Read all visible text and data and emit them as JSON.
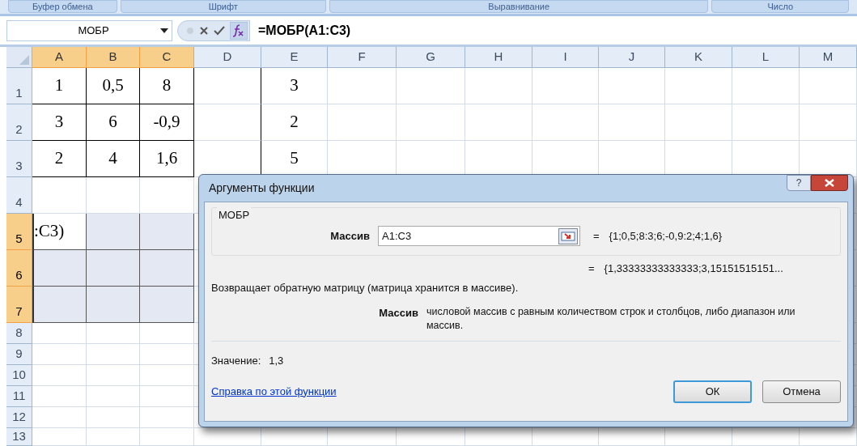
{
  "ribbon_groups": [
    "Буфер обмена",
    "Шрифт",
    "Выравнивание",
    "Число"
  ],
  "formula_bar": {
    "name_box": "МОБР",
    "formula": "=МОБР(A1:C3)"
  },
  "columns": [
    {
      "label": "A",
      "selected": true
    },
    {
      "label": "B",
      "selected": true
    },
    {
      "label": "C",
      "selected": true
    },
    {
      "label": "D",
      "selected": false
    },
    {
      "label": "E",
      "selected": false
    },
    {
      "label": "F",
      "selected": false
    },
    {
      "label": "G",
      "selected": false
    },
    {
      "label": "H",
      "selected": false
    },
    {
      "label": "I",
      "selected": false
    },
    {
      "label": "J",
      "selected": false
    },
    {
      "label": "K",
      "selected": false
    },
    {
      "label": "L",
      "selected": false
    },
    {
      "label": "M",
      "selected": false
    }
  ],
  "rows": [
    {
      "label": "1",
      "selected": false,
      "cells": [
        "1",
        "0,5",
        "8",
        null,
        "3"
      ]
    },
    {
      "label": "2",
      "selected": false,
      "cells": [
        "3",
        "6",
        "-0,9",
        null,
        "2"
      ]
    },
    {
      "label": "3",
      "selected": false,
      "cells": [
        "2",
        "4",
        "1,6",
        null,
        "5"
      ]
    },
    {
      "label": "4",
      "selected": false
    },
    {
      "label": "5",
      "selected": true,
      "cells": [
        ":C3)"
      ]
    },
    {
      "label": "6",
      "selected": true
    },
    {
      "label": "7",
      "selected": true
    },
    {
      "label": "8",
      "selected": false
    },
    {
      "label": "9",
      "selected": false
    },
    {
      "label": "10",
      "selected": false
    },
    {
      "label": "11",
      "selected": false
    },
    {
      "label": "12",
      "selected": false
    },
    {
      "label": "13",
      "selected": false
    }
  ],
  "dialog": {
    "title": "Аргументы функции",
    "help_button": "?",
    "function_name": "МОБР",
    "argument": {
      "label": "Массив",
      "value": "A1:C3",
      "equals": "=",
      "result": "{1;0,5;8:3;6;-0,9:2;4;1,6}"
    },
    "result": {
      "equals": "=",
      "value": "{1,33333333333333;3,15151515151..."
    },
    "description": "Возвращает обратную матрицу (матрица хранится в массиве).",
    "argument_help": {
      "label": "Массив",
      "text": "числовой массив с равным количеством строк и столбцов, либо диапазон или массив."
    },
    "value_label": "Значение:",
    "value": "1,3",
    "help_link": "Справка по этой функции",
    "buttons": [
      {
        "label": "ОК",
        "default": true
      },
      {
        "label": "Отмена",
        "default": false
      }
    ]
  }
}
